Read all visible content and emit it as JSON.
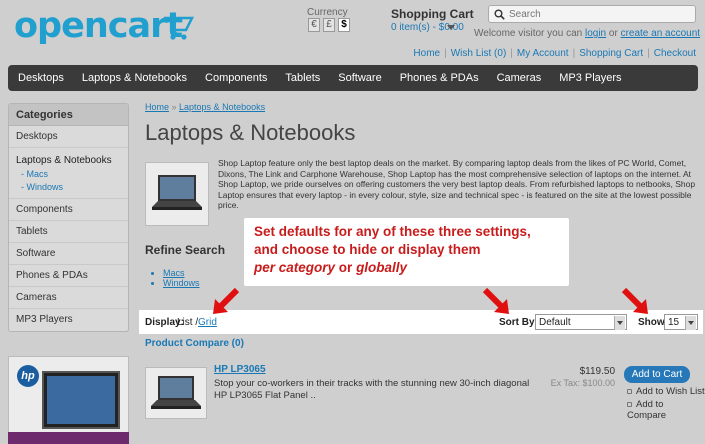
{
  "brand": {
    "logo_text": "opencart"
  },
  "header": {
    "currency_label": "Currency",
    "currencies": [
      "€",
      "£",
      "$"
    ],
    "cart_title": "Shopping Cart",
    "cart_summary": "0 item(s) - $0.00",
    "search_placeholder": "Search",
    "welcome_prefix": "Welcome visitor you can ",
    "login": "login",
    "or": " or ",
    "create_account": "create an account",
    "links": [
      "Home",
      "Wish List (0)",
      "My Account",
      "Shopping Cart",
      "Checkout"
    ]
  },
  "menu": [
    "Desktops",
    "Laptops & Notebooks",
    "Components",
    "Tablets",
    "Software",
    "Phones & PDAs",
    "Cameras",
    "MP3 Players"
  ],
  "sidebar": {
    "title": "Categories",
    "items": [
      "Desktops",
      "Laptops & Notebooks",
      "Components",
      "Tablets",
      "Software",
      "Phones & PDAs",
      "Cameras",
      "MP3 Players"
    ],
    "subitems": [
      "- Macs",
      "- Windows"
    ]
  },
  "main": {
    "breadcrumb_home": "Home",
    "breadcrumb_sep": " » ",
    "breadcrumb_current": "Laptops & Notebooks",
    "title": "Laptops & Notebooks",
    "description": "Shop Laptop feature only the best laptop deals on the market. By comparing laptop deals from the likes of PC World, Comet, Dixons, The Link and Carphone Warehouse, Shop Laptop has the most comprehensive selection of laptops on the internet. At Shop Laptop, we pride ourselves on offering customers the very best laptop deals. From refurbished laptops to netbooks, Shop Laptop ensures that every laptop - in every colour, style, size and technical spec - is featured on the site at the lowest possible price.",
    "refine_title": "Refine Search",
    "refine_items": [
      "Macs",
      "Windows"
    ]
  },
  "callout": {
    "line1": "Set defaults for any of these three settings,",
    "line2": "and choose to hide or display them",
    "line3_em1": "per category",
    "line3_or": " or ",
    "line3_em2": "globally"
  },
  "toolbar": {
    "display_label": "Display:",
    "list": "List",
    "slash": " / ",
    "grid": "Grid",
    "sort_label": "Sort By:",
    "sort_value": "Default",
    "show_label": "Show:",
    "show_value": "15",
    "compare": "Product Compare (0)"
  },
  "product": {
    "name": "HP LP3065",
    "description": "Stop your co-workers in their tracks with the stunning new 30-inch diagonal HP LP3065 Flat Panel ..",
    "price": "$119.50",
    "ex_tax": "Ex Tax: $100.00",
    "add_to_cart": "Add to Cart",
    "wishlist": "Add to Wish List",
    "compare": "Add to Compare"
  },
  "banner": {
    "logo": "hp"
  },
  "colors": {
    "accent": "#21a0cf",
    "callout_text": "#c81b1b",
    "menu_bg": "#3a3a3a",
    "arrow": "#e01010"
  }
}
